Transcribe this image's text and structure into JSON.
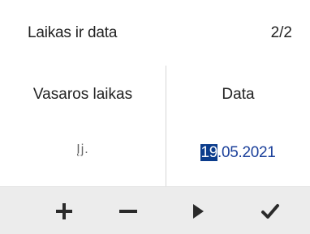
{
  "header": {
    "title": "Laikas ir data",
    "page_indicator": "2/2"
  },
  "columns": {
    "left": {
      "label": "Vasaros laikas",
      "value": "Įj."
    },
    "right": {
      "label": "Data",
      "value_highlight": "19",
      "value_rest": ".05.2021"
    }
  },
  "toolbar": {
    "buttons": [
      {
        "icon": "plus-icon"
      },
      {
        "icon": "minus-icon"
      },
      {
        "icon": "play-icon"
      },
      {
        "icon": "check-icon"
      }
    ]
  },
  "colors": {
    "background": "#ffffff",
    "toolbar": "#ececec",
    "accent": "#0b3c8c",
    "date_text": "#1a3f9a"
  }
}
